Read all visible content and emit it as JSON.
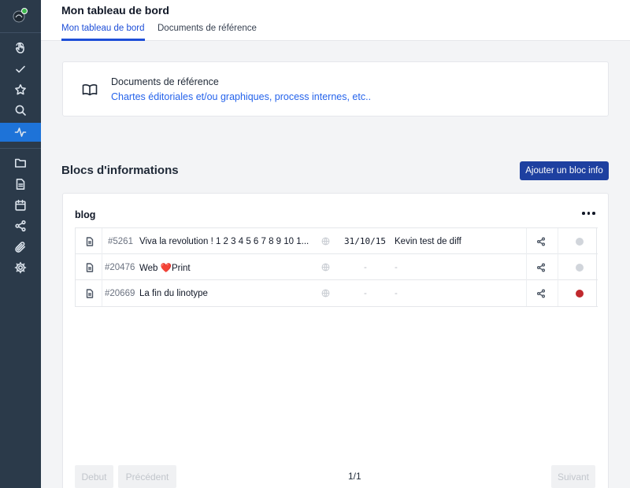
{
  "header": {
    "title": "Mon tableau de bord",
    "tabs": [
      {
        "label": "Mon tableau de bord",
        "active": true
      },
      {
        "label": "Documents de référence",
        "active": false
      }
    ]
  },
  "sidebar": {
    "items": [
      {
        "icon": "hand-pointer-icon"
      },
      {
        "icon": "check-icon"
      },
      {
        "icon": "star-icon"
      },
      {
        "icon": "search-icon"
      },
      {
        "icon": "activity-icon",
        "active": true
      },
      {
        "icon": "folder-icon"
      },
      {
        "icon": "document-icon"
      },
      {
        "icon": "calendar-icon"
      },
      {
        "icon": "share-icon"
      },
      {
        "icon": "paperclip-icon"
      },
      {
        "icon": "gear-icon"
      }
    ],
    "active_color": "#1e73d8",
    "background": "#2b3a4a"
  },
  "reference_card": {
    "title": "Documents de référence",
    "link": "Chartes éditoriales et/ou graphiques, process internes, etc.."
  },
  "section": {
    "title": "Blocs d'informations",
    "add_button": "Ajouter un bloc info"
  },
  "blog": {
    "title": "blog",
    "rows": [
      {
        "id": "#5261",
        "title": "Viva la revolution ! 1 2 3 4 5 6 7 8 9 10 1...",
        "date": "31/10/15",
        "author": "Kevin test de diff",
        "status_color": "#d1d5db"
      },
      {
        "id": "#20476",
        "title": "Web ❤️Print",
        "date": "-",
        "author": "-",
        "status_color": "#d1d5db"
      },
      {
        "id": "#20669",
        "title": "La fin du linotype",
        "date": "-",
        "author": "-",
        "status_color": "#c0282d"
      }
    ]
  },
  "pagination": {
    "first": "Debut",
    "previous": "Précédent",
    "count": "1/1",
    "next": "Suivant"
  }
}
